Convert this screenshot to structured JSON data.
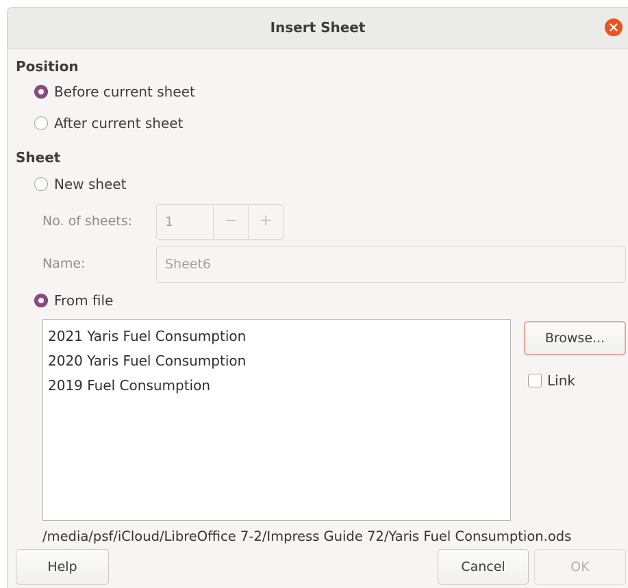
{
  "dialog": {
    "title": "Insert Sheet",
    "accent_color": "#8c4a84",
    "close_color": "#e95420"
  },
  "position": {
    "heading": "Position",
    "options": [
      {
        "label": "Before current sheet",
        "selected": true
      },
      {
        "label": "After current sheet",
        "selected": false
      }
    ]
  },
  "sheet": {
    "heading": "Sheet",
    "new_sheet": {
      "label": "New sheet",
      "selected": false
    },
    "no_of_sheets": {
      "label": "No. of sheets:",
      "value": "1",
      "minus": "−",
      "plus": "+"
    },
    "name": {
      "label": "Name:",
      "placeholder": "Sheet6"
    },
    "from_file": {
      "label": "From file",
      "selected": true
    },
    "file_sheets": [
      "2021 Yaris Fuel Consumption",
      "2020 Yaris Fuel Consumption",
      "2019 Fuel Consumption"
    ],
    "browse_label": "Browse...",
    "link_label": "Link",
    "file_path": "/media/psf/iCloud/LibreOffice 7-2/Impress Guide 72/Yaris Fuel Consumption.ods"
  },
  "footer": {
    "help_label": "Help",
    "cancel_label": "Cancel",
    "ok_label": "OK"
  }
}
